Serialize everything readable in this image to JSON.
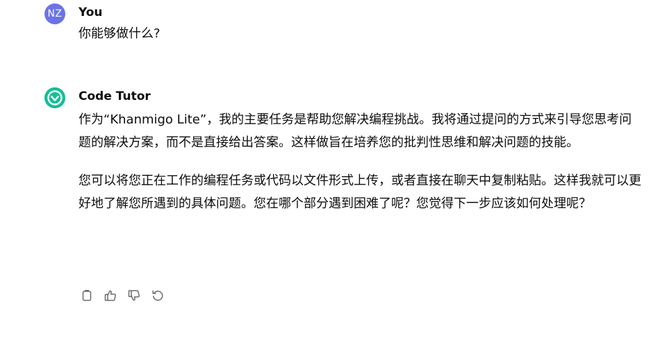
{
  "messages": [
    {
      "role": "user",
      "avatar_initials": "NZ",
      "sender": "You",
      "text": "你能够做什么?"
    },
    {
      "role": "assistant",
      "avatar_icon": "khanmigo-logo-icon",
      "sender": "Code Tutor",
      "paragraphs": [
        "作为“Khanmigo Lite”，我的主要任务是帮助您解决编程挑战。我将通过提问的方式来引导您思考问题的解决方案，而不是直接给出答案。这样做旨在培养您的批判性思维和解决问题的技能。",
        "您可以将您正在工作的编程任务或代码以文件形式上传，或者直接在聊天中复制粘贴。这样我就可以更好地了解您所遇到的具体问题。您在哪个部分遇到困难了呢？您觉得下一步应该如何处理呢？"
      ],
      "actions": [
        {
          "icon": "copy-icon"
        },
        {
          "icon": "thumbs-up-icon"
        },
        {
          "icon": "thumbs-down-icon"
        },
        {
          "icon": "regenerate-icon"
        }
      ]
    }
  ],
  "colors": {
    "user_avatar_bg": "#6b73e6",
    "bot_avatar_bg": "#14bf96",
    "text": "#0d0d0d",
    "icon": "#6b6b6b"
  }
}
